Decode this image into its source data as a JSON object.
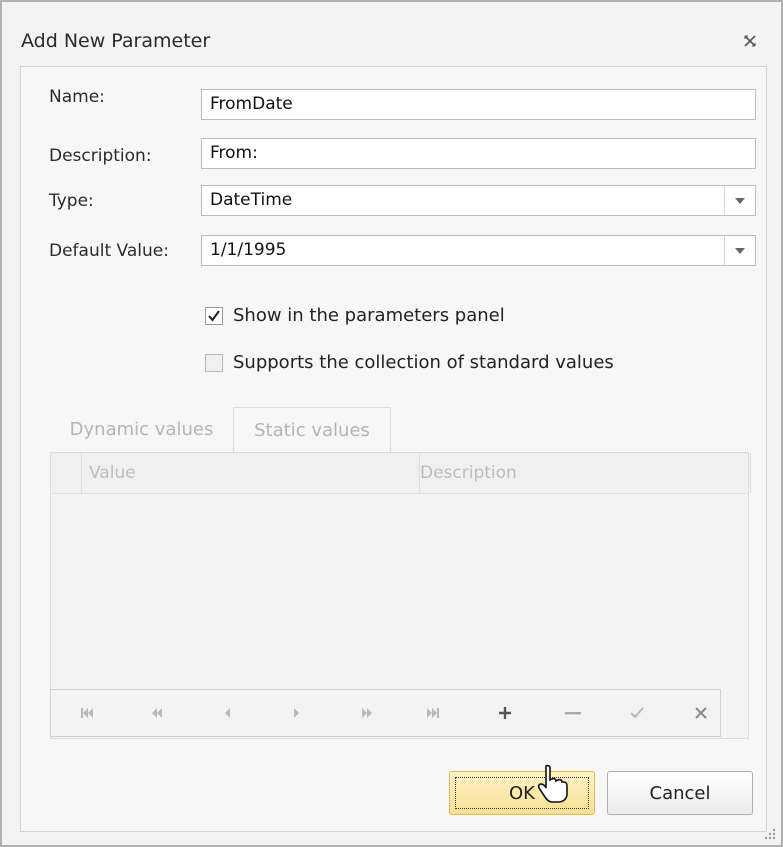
{
  "dialog": {
    "title": "Add New Parameter",
    "close_icon": "close-icon"
  },
  "form": {
    "name_label": "Name:",
    "name_value": "FromDate",
    "description_label": "Description:",
    "description_value": "From:",
    "type_label": "Type:",
    "type_value": "DateTime",
    "default_label": "Default Value:",
    "default_value": "1/1/1995"
  },
  "options": {
    "show_in_panel_label": "Show in the parameters panel",
    "show_in_panel_checked": true,
    "supports_standard_label": "Supports the collection of standard values",
    "supports_standard_checked": false
  },
  "tabs": [
    {
      "label": "Dynamic values",
      "active": false
    },
    {
      "label": "Static values",
      "active": true
    }
  ],
  "grid": {
    "columns": [
      "Value",
      "Description"
    ],
    "rows": []
  },
  "navigator": {
    "buttons": [
      "first-icon",
      "prev-page-icon",
      "prev-icon",
      "next-icon",
      "next-page-icon",
      "last-icon",
      "add-icon",
      "remove-icon",
      "apply-icon",
      "cancel-edit-icon"
    ]
  },
  "buttons": {
    "ok": "OK",
    "cancel": "Cancel"
  },
  "colors": {
    "ok_button": "#f8df93",
    "ok_border": "#e2b65a"
  }
}
